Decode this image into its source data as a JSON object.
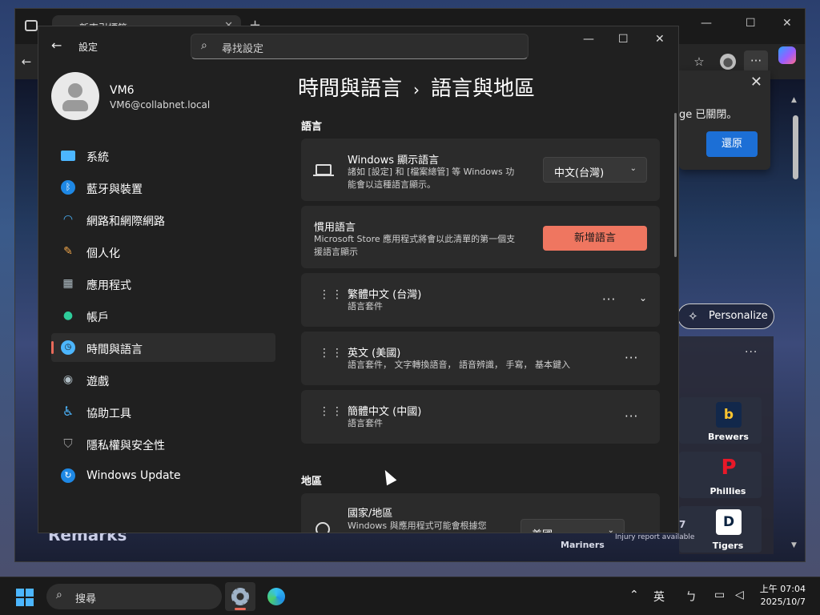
{
  "browser": {
    "tab_title": "新索引標籤",
    "popup": {
      "text": "ge 已關閉。",
      "restore_label": "還原"
    },
    "personalize_label": "Personalize",
    "teams": [
      {
        "name": "Brewers",
        "logo_color": "#12284b",
        "logo_text": "b"
      },
      {
        "name": "Phillies",
        "logo_color": "#e81828",
        "logo_text": "P"
      },
      {
        "name": "Tigers",
        "logo_color": "#0c2340",
        "logo_text": "D"
      }
    ],
    "background_texts": {
      "remarks": "Remarks",
      "mariners": "Mariners",
      "injury": "Injury report available",
      "seven": "7"
    }
  },
  "settings": {
    "app_title": "設定",
    "search_placeholder": "尋找設定",
    "profile": {
      "name": "VM6",
      "email": "VM6@collabnet.local"
    },
    "nav": [
      {
        "label": "系統",
        "icon": "system-icon",
        "color": "#4cb6ff"
      },
      {
        "label": "藍牙與裝置",
        "icon": "bluetooth-icon",
        "color": "#1e88e5"
      },
      {
        "label": "網路和網際網路",
        "icon": "wifi-icon",
        "color": "#4cb6ff"
      },
      {
        "label": "個人化",
        "icon": "brush-icon",
        "color": "#f2a74b"
      },
      {
        "label": "應用程式",
        "icon": "apps-icon",
        "color": "#b0bec5"
      },
      {
        "label": "帳戶",
        "icon": "account-icon",
        "color": "#2ecc9a"
      },
      {
        "label": "時間與語言",
        "icon": "time-language-icon",
        "color": "#4cb6ff"
      },
      {
        "label": "遊戲",
        "icon": "gaming-icon",
        "color": "#b0bec5"
      },
      {
        "label": "協助工具",
        "icon": "accessibility-icon",
        "color": "#4cb6ff"
      },
      {
        "label": "隱私權與安全性",
        "icon": "shield-icon",
        "color": "#9e9e9e"
      },
      {
        "label": "Windows Update",
        "icon": "update-icon",
        "color": "#1e88e5"
      }
    ],
    "active_nav": "時間與語言",
    "breadcrumb": {
      "parent": "時間與語言",
      "separator": "›",
      "current": "語言與地區"
    },
    "language_section": {
      "heading": "語言",
      "display_language": {
        "title": "Windows 顯示語言",
        "desc_line1": "諸如 [設定] 和 [檔案總管] 等 Windows 功",
        "desc_line2": "能會以這種語言顯示。",
        "value": "中文(台灣)"
      },
      "preferred": {
        "title": "慣用語言",
        "desc_line1": "Microsoft Store 應用程式將會以此清單的第一個支",
        "desc_line2": "援語言顯示",
        "add_label": "新增語言"
      },
      "languages": [
        {
          "name": "繁體中文 (台灣)",
          "features": "語言套件"
        },
        {
          "name": "英文 (美國)",
          "features": "語言套件， 文字轉換語音， 語音辨識， 手寫， 基本鍵入"
        },
        {
          "name": "簡體中文 (中國)",
          "features": "語言套件"
        }
      ]
    },
    "region_section": {
      "heading": "地區",
      "country": {
        "title": "國家/地區",
        "desc": "Windows 與應用程式可能會根據您",
        "value": "美國"
      }
    }
  },
  "taskbar": {
    "search_placeholder": "搜尋",
    "ime_label": "英",
    "clock_time": "上午 07:04",
    "clock_date": "2025/10/7"
  }
}
